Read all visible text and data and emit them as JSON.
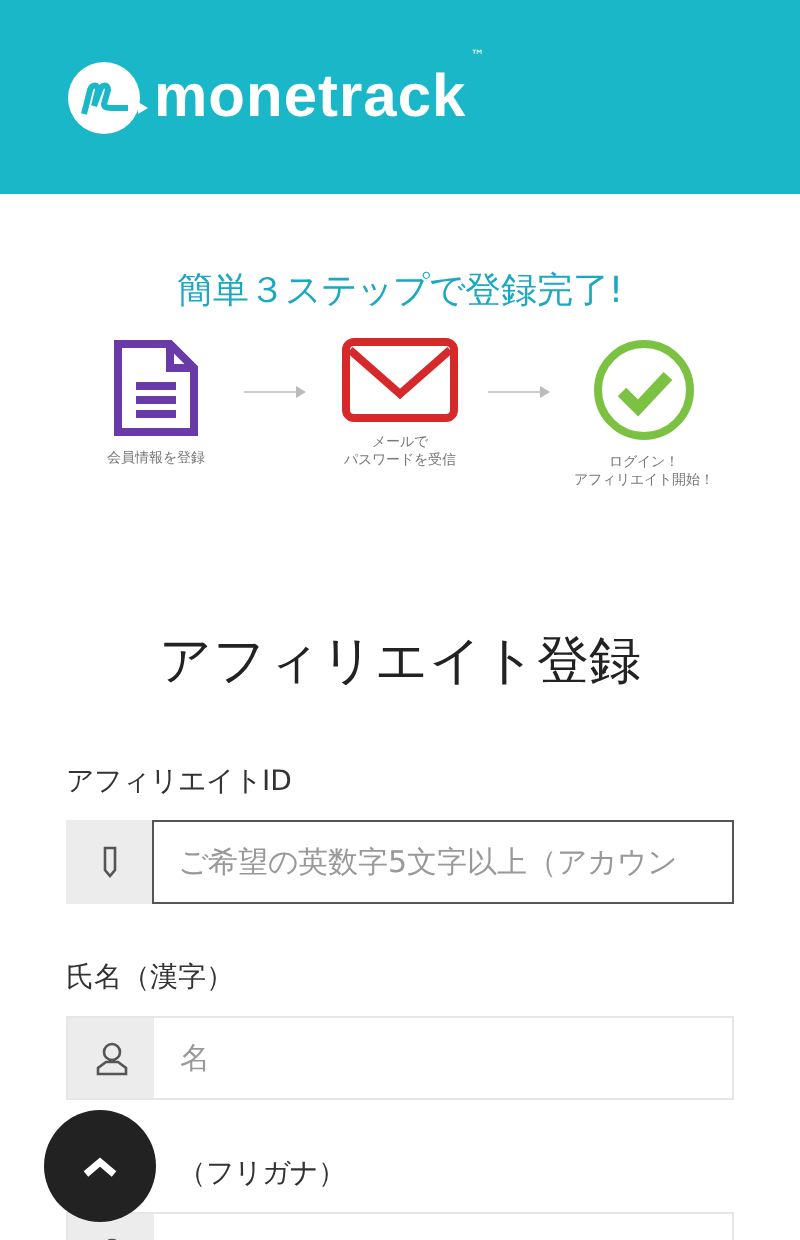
{
  "header": {
    "logo_text": "monetrack",
    "trademark": "™"
  },
  "steps_title": "簡単３ステップで登録完了!",
  "steps": [
    {
      "kind": "document",
      "caption": [
        "会員情報を登録"
      ]
    },
    {
      "kind": "mail",
      "caption": [
        "メールで",
        "パスワードを受信"
      ]
    },
    {
      "kind": "check",
      "caption": [
        "ログイン！",
        "アフィリエイト開始！"
      ]
    }
  ],
  "form_title": "アフィリエイト登録",
  "fields": [
    {
      "label": "アフィリエイトID",
      "placeholder": "ご希望の英数字5文字以上（アカウン",
      "focused": true
    },
    {
      "label": "氏名（漢字）",
      "placeholder": "名",
      "focused": false
    },
    {
      "label": "（フリガナ）",
      "focused": false
    }
  ]
}
